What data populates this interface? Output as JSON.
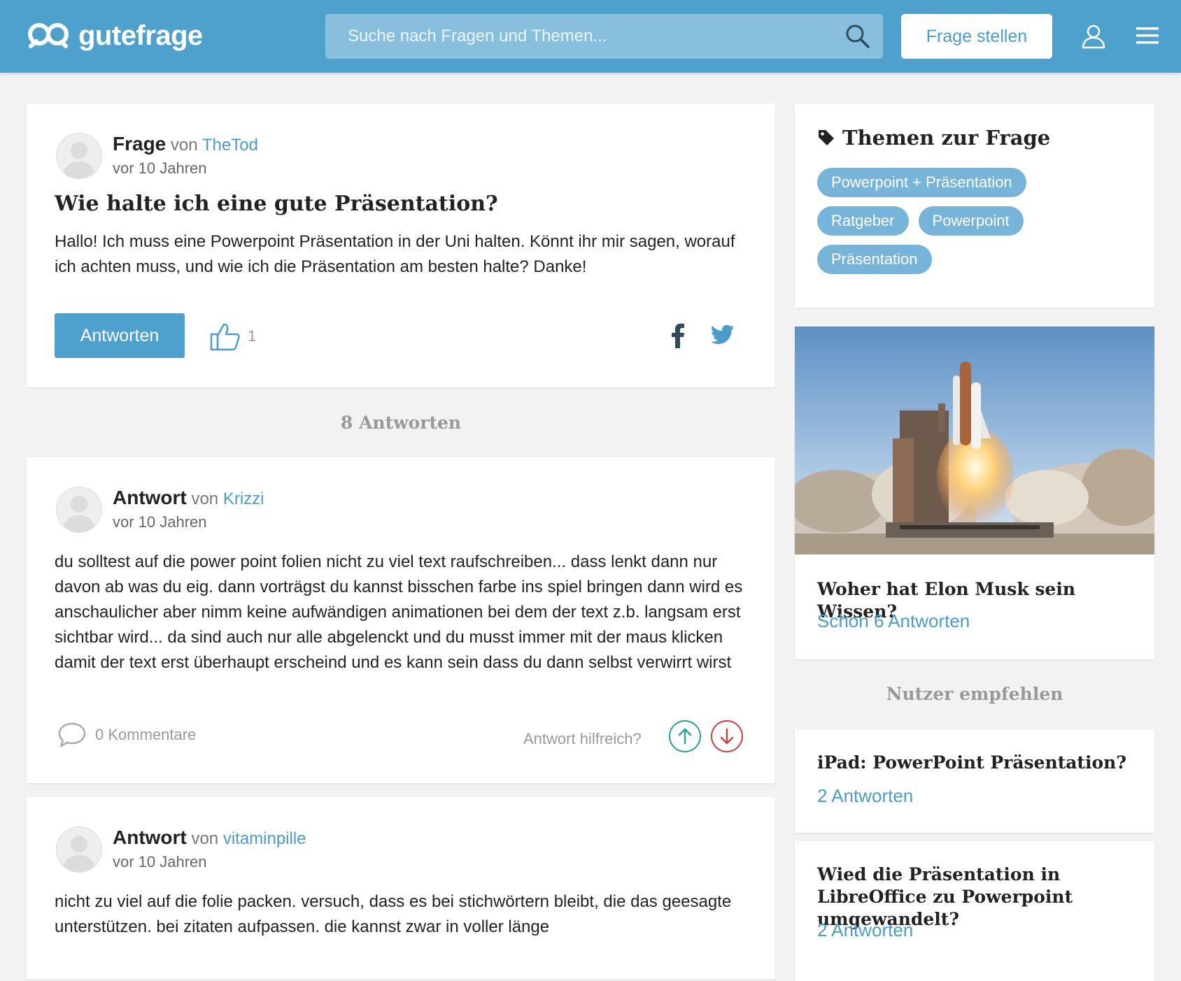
{
  "header": {
    "logo_text": "gutefrage",
    "search_placeholder": "Suche nach Fragen und Themen...",
    "ask_button": "Frage stellen"
  },
  "question": {
    "kind": "Frage",
    "von": "von",
    "author": "TheTod",
    "time": "vor 10 Jahren",
    "title": "Wie halte ich eine gute Präsentation?",
    "body": "Hallo! Ich muss eine Powerpoint Präsentation in der Uni halten. Könnt ihr mir sagen, worauf ich achten muss, und wie ich die Präsentation am besten halte? Danke!",
    "answer_button": "Antworten",
    "likes": "1"
  },
  "answers_count": "8 Antworten",
  "answers": [
    {
      "kind": "Antwort",
      "von": "von",
      "author": "Krizzi",
      "time": "vor 10 Jahren",
      "body": "du solltest auf die power point folien nicht zu viel text raufschreiben... dass lenkt dann nur davon ab was du eig. dann vorträgst du kannst bisschen farbe ins spiel bringen dann wird es anschaulicher aber nimm keine aufwändigen animationen bei dem der text z.b. langsam erst sichtbar wird... da sind auch nur alle abgelenckt und du musst immer mit der maus klicken damit der text erst überhaupt erscheind und es kann sein dass du dann selbst verwirrt wirst",
      "comments": "0 Kommentare",
      "helpful": "Antwort hilfreich?"
    },
    {
      "kind": "Antwort",
      "von": "von",
      "author": "vitaminpille",
      "time": "vor 10 Jahren",
      "body": "nicht zu viel auf die folie packen. versuch, dass es bei stichwörtern bleibt, die das geesagte unterstützen. bei zitaten aufpassen. die kannst zwar in voller länge"
    }
  ],
  "sidebar": {
    "topics_title": "Themen zur Frage",
    "tags": [
      "Powerpoint + Präsentation",
      "Ratgeber",
      "Powerpoint",
      "Präsentation"
    ],
    "promo": {
      "title": "Woher hat Elon Musk sein Wissen?",
      "link": "Schon 6 Antworten"
    },
    "recommend_title": "Nutzer empfehlen",
    "related": [
      {
        "title": "iPad: PowerPoint Präsentation?",
        "link": "2 Antworten"
      },
      {
        "title": "Wied die Präsentation in LibreOffice zu Powerpoint umgewandelt?",
        "link": "2 Antworten"
      }
    ]
  },
  "colors": {
    "brand": "#4fa1cd",
    "link": "#4a9ccb",
    "tag": "#76b4da",
    "vote_up": "#2aa39a",
    "vote_down": "#c9423f"
  }
}
